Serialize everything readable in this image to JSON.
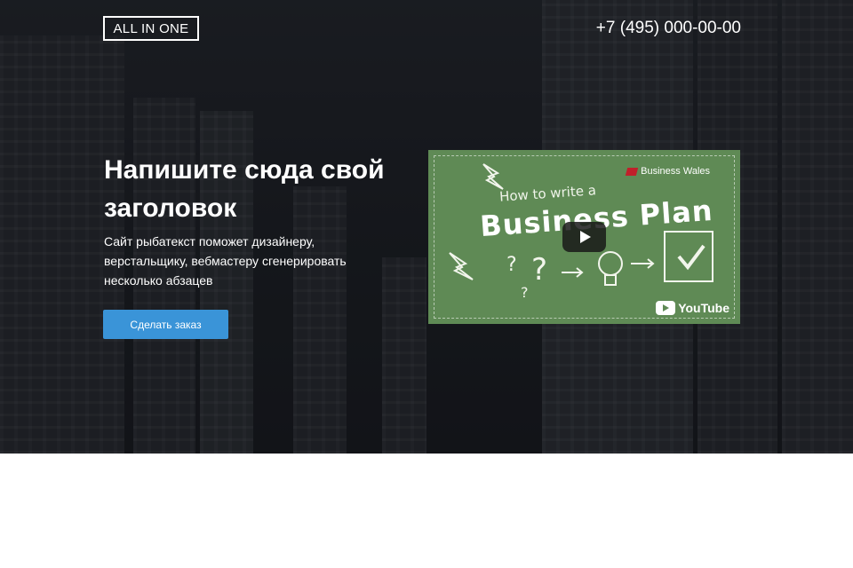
{
  "header": {
    "logo_text": "ALL IN ONE",
    "phone": "+7 (495) 000-00-00"
  },
  "hero": {
    "title": "Напишите сюда свой заголовок",
    "subtitle": "Сайт рыбатекст поможет дизайнеру, верстальщику, вебмастеру сгенерировать несколько абзацев",
    "cta_label": "Сделать заказ"
  },
  "video": {
    "brand": "Business Wales",
    "chalk_line1": "How to write a",
    "chalk_line2": "Business Plan",
    "platform": "YouTube"
  },
  "colors": {
    "accent": "#3a94d8",
    "hero_bg": "#1f2226",
    "video_board": "#5f8a55"
  },
  "icons": [
    "play-icon",
    "youtube-icon",
    "business-wales-icon"
  ]
}
